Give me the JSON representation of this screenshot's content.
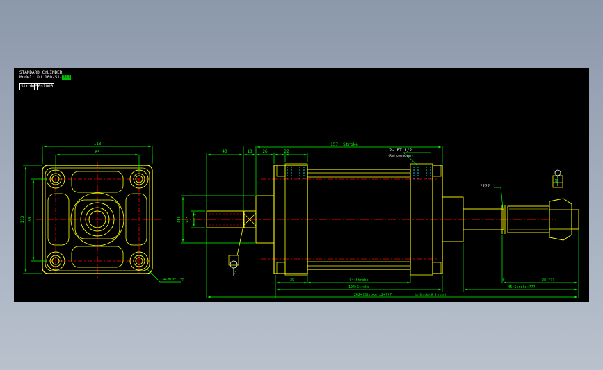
{
  "header": {
    "title": "STANDARD CYLINDER",
    "model_prefix": "Model: DU 100-S1-",
    "model_suffix": "???",
    "stroke_label": "Stroke",
    "stroke_range": "50~1000"
  },
  "front_view": {
    "dim_width_outer": "113",
    "dim_width_inner": "85",
    "dim_height_outer": "113",
    "dim_height_inner": "85",
    "thread_note": "4-M10x1.5p"
  },
  "side_view": {
    "dim_rod_ext": "40",
    "dim_13": "13",
    "dim_26": "26",
    "dim_22": "22",
    "dim_total_top": "157+ Stroke",
    "port_note": "2- PT 1/2",
    "port_sub": "(Rod connector)",
    "dia_50": "Ø50",
    "dia_25": "Ø25",
    "thread_rod": "M20x1.5p",
    "dim_port_22": "22",
    "dim_39": "39",
    "dim_stroke_mid": "94+Stroke",
    "dim_124": "124+Stroke",
    "dim_overall": "262+(Stroke)x2+???",
    "dim_overall_note": "(A Stroke,B Stroke)",
    "dim_0": "0",
    "dim_rod_end": "28+???",
    "dim_45": "45+Stroke+???",
    "question_label": "????",
    "dim_41": "41"
  },
  "colors": {
    "background": "#000000",
    "outline": "#ffff00",
    "dimension": "#00ff00",
    "centerline": "#ff0000",
    "port": "#00ffff",
    "text": "#ffffff"
  }
}
